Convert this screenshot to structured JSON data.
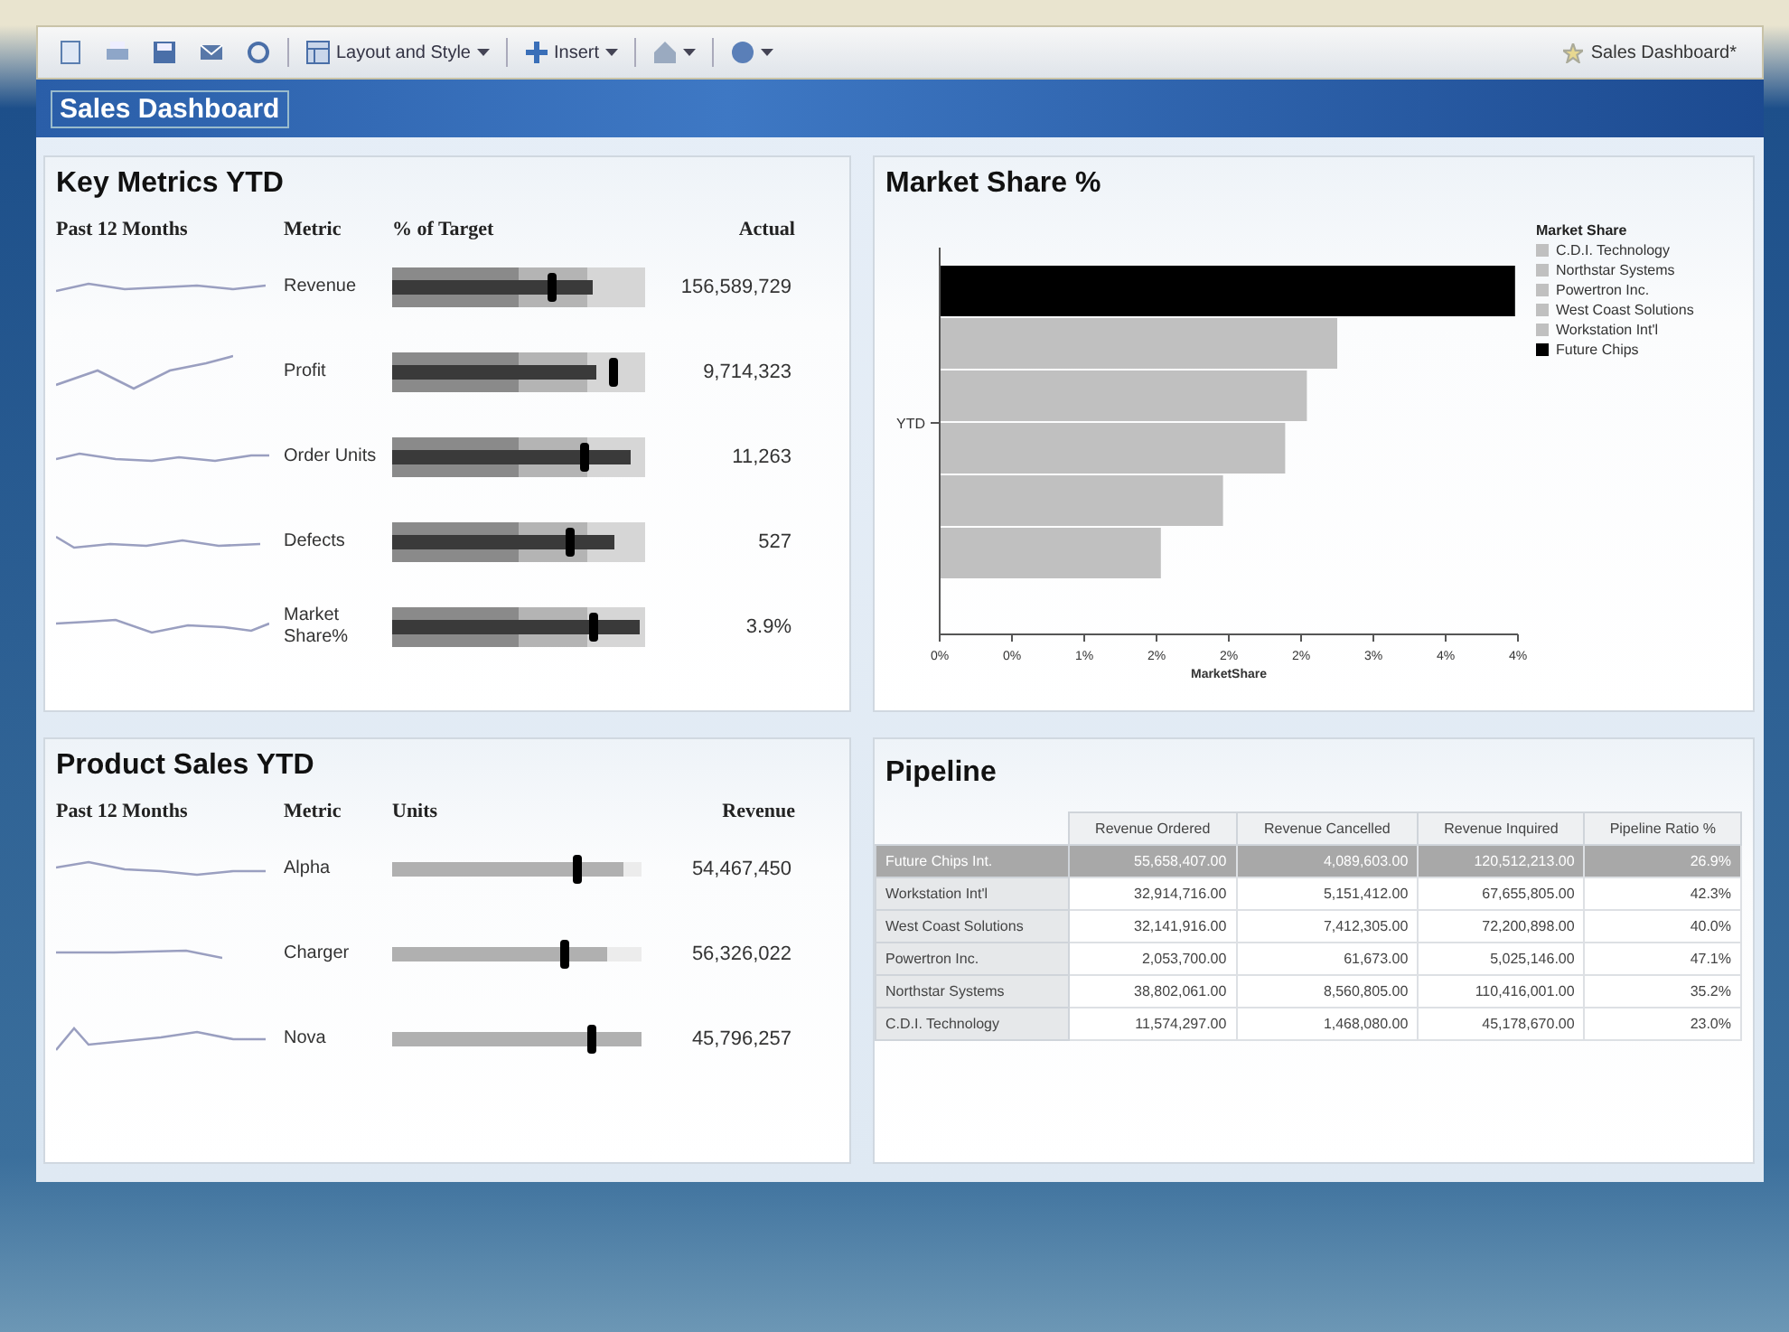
{
  "toolbar": {
    "items": [
      {
        "kind": "icon"
      },
      {
        "kind": "icon"
      },
      {
        "kind": "icon"
      },
      {
        "kind": "icon"
      },
      {
        "kind": "icon"
      },
      {
        "kind": "menu",
        "label": "Layout and Style"
      },
      {
        "kind": "menu",
        "label": "Insert"
      },
      {
        "kind": "menu"
      },
      {
        "kind": "menu"
      }
    ],
    "document_title": "Sales Dashboard*"
  },
  "header": {
    "title": "Sales Dashboard"
  },
  "key_metrics": {
    "title": "Key Metrics YTD",
    "columns": [
      "Past 12 Months",
      "Metric",
      "% of Target",
      "Actual"
    ],
    "rows": [
      {
        "metric": "Revenue",
        "level": 0.79,
        "target_marker": {
          "level": 0.63
        },
        "actual": "156,589,729"
      },
      {
        "metric": "Profit",
        "level": 0.81,
        "target_marker": {
          "level": 0.87
        },
        "actual": "9,714,323"
      },
      {
        "metric": "Order Units",
        "level": 0.94,
        "target_marker": {
          "level": 0.76
        },
        "actual": "11,263"
      },
      {
        "metric": "Defects",
        "level": 0.88,
        "target_marker": {
          "level": 0.7
        },
        "actual": "527"
      },
      {
        "metric": "Market Share%",
        "level": 0.98,
        "target_marker": {
          "level": 0.79
        },
        "actual": "3.9%"
      }
    ]
  },
  "market_share": {
    "title": "Market Share %",
    "chart_data": {
      "type": "bar",
      "orientation": "horizontal",
      "xlabel": "MarketShare",
      "categories": [
        "YTD"
      ],
      "xlim": [
        0,
        4
      ],
      "xticks": [
        {
          "value": 0,
          "label": "0%"
        },
        {
          "value": 0.5,
          "label": "0%"
        },
        {
          "value": 1,
          "label": "1%"
        },
        {
          "value": 1.5,
          "label": "2%"
        },
        {
          "value": 2,
          "label": "2%"
        },
        {
          "value": 2.5,
          "label": "2%"
        },
        {
          "value": 3,
          "label": "3%"
        },
        {
          "value": 3.5,
          "label": "4%"
        },
        {
          "value": 4,
          "label": "4%"
        }
      ],
      "legend": "right",
      "legend_title": "Market Share",
      "series": [
        {
          "name": "C.D.I. Technology",
          "color": "#c0c0c0",
          "values": [
            1.53
          ]
        },
        {
          "name": "Northstar Systems",
          "color": "#c0c0c0",
          "values": [
            1.96
          ]
        },
        {
          "name": "Powertron Inc.",
          "color": "#c0c0c0",
          "values": [
            2.39
          ]
        },
        {
          "name": "West Coast Solutions",
          "color": "#c0c0c0",
          "values": [
            2.54
          ]
        },
        {
          "name": "Workstation Int'l",
          "color": "#c0c0c0",
          "values": [
            2.75
          ]
        },
        {
          "name": "Future Chips",
          "color": "#000000",
          "values": [
            3.98
          ]
        }
      ]
    }
  },
  "product_sales": {
    "title": "Product Sales YTD",
    "columns": [
      "Past 12 Months",
      "Metric",
      "Units",
      "Revenue"
    ],
    "rows": [
      {
        "metric": "Alpha",
        "level": 0.93,
        "target_marker": {
          "level": 0.74
        },
        "revenue": "54,467,450"
      },
      {
        "metric": "Charger",
        "level": 0.86,
        "target_marker": {
          "level": 0.69
        },
        "revenue": "56,326,022"
      },
      {
        "metric": "Nova",
        "level": 1.0,
        "target_marker": {
          "level": 0.8
        },
        "revenue": "45,796,257"
      }
    ]
  },
  "pipeline": {
    "title": "Pipeline",
    "columns": [
      "Revenue Ordered",
      "Revenue Cancelled",
      "Revenue Inquired",
      "Pipeline Ratio %"
    ],
    "rows": [
      {
        "name": "Future Chips Int.",
        "selected": true,
        "cells": [
          "55,658,407.00",
          "4,089,603.00",
          "120,512,213.00",
          "26.9%"
        ]
      },
      {
        "name": "Workstation Int'l",
        "selected": false,
        "cells": [
          "32,914,716.00",
          "5,151,412.00",
          "67,655,805.00",
          "42.3%"
        ]
      },
      {
        "name": "West Coast Solutions",
        "selected": false,
        "cells": [
          "32,141,916.00",
          "7,412,305.00",
          "72,200,898.00",
          "40.0%"
        ]
      },
      {
        "name": "Powertron Inc.",
        "selected": false,
        "cells": [
          "2,053,700.00",
          "61,673.00",
          "5,025,146.00",
          "47.1%"
        ]
      },
      {
        "name": "Northstar Systems",
        "selected": false,
        "cells": [
          "38,802,061.00",
          "8,560,805.00",
          "110,416,001.00",
          "35.2%"
        ]
      },
      {
        "name": "C.D.I. Technology",
        "selected": false,
        "cells": [
          "11,574,297.00",
          "1,468,080.00",
          "45,178,670.00",
          "23.0%"
        ]
      }
    ]
  }
}
